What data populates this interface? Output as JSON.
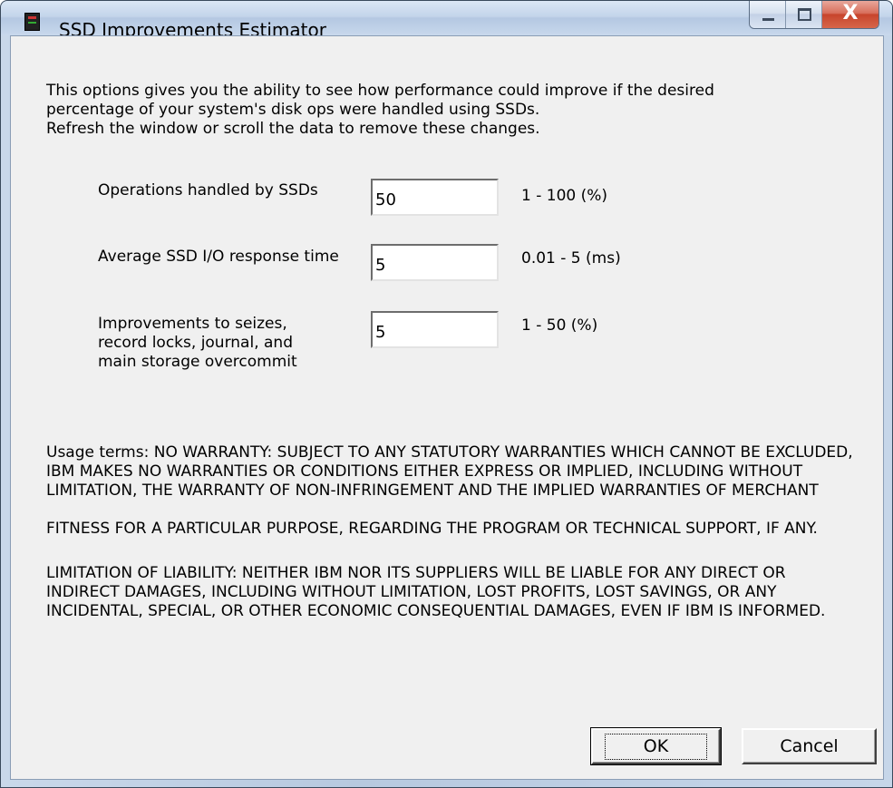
{
  "window": {
    "title": "SSD Improvements Estimator",
    "close_symbol": "X"
  },
  "intro_lines": [
    "This options gives you the ability to see how performance could improve if the desired",
    "percentage of your system's disk ops were handled using SSDs.",
    "Refresh the window or scroll the data to remove these changes."
  ],
  "fields": [
    {
      "label": "Operations handled by SSDs",
      "value": "50",
      "range": "1 - 100 (%)"
    },
    {
      "label": "Average SSD I/O response time",
      "value": "5",
      "range": "0.01 - 5 (ms)"
    },
    {
      "label": "Improvements to seizes, record locks, journal, and main storage overcommit",
      "value": "5",
      "range": "1 - 50 (%)"
    }
  ],
  "terms": {
    "usage_1": "Usage terms: NO WARRANTY: SUBJECT TO ANY STATUTORY WARRANTIES WHICH CANNOT BE EXCLUDED, IBM MAKES NO WARRANTIES OR CONDITIONS EITHER EXPRESS OR IMPLIED, INCLUDING WITHOUT LIMITATION, THE WARRANTY OF NON-INFRINGEMENT AND THE IMPLIED WARRANTIES OF MERCHANT",
    "usage_2": "FITNESS FOR A PARTICULAR PURPOSE, REGARDING THE PROGRAM OR TECHNICAL SUPPORT, IF ANY.",
    "liability": "LIMITATION OF LIABILITY: NEITHER IBM NOR ITS SUPPLIERS WILL BE LIABLE FOR ANY DIRECT OR INDIRECT DAMAGES, INCLUDING WITHOUT LIMITATION, LOST PROFITS, LOST SAVINGS, OR ANY INCIDENTAL, SPECIAL, OR OTHER ECONOMIC CONSEQUENTIAL DAMAGES, EVEN IF IBM IS INFORMED."
  },
  "buttons": {
    "ok": "OK",
    "cancel": "Cancel"
  },
  "colors": {
    "close_button": "#c7452c",
    "dialog_background": "#f0f0f0"
  },
  "icons": [
    "app-icon",
    "minimize-icon",
    "maximize-icon",
    "close-icon"
  ]
}
